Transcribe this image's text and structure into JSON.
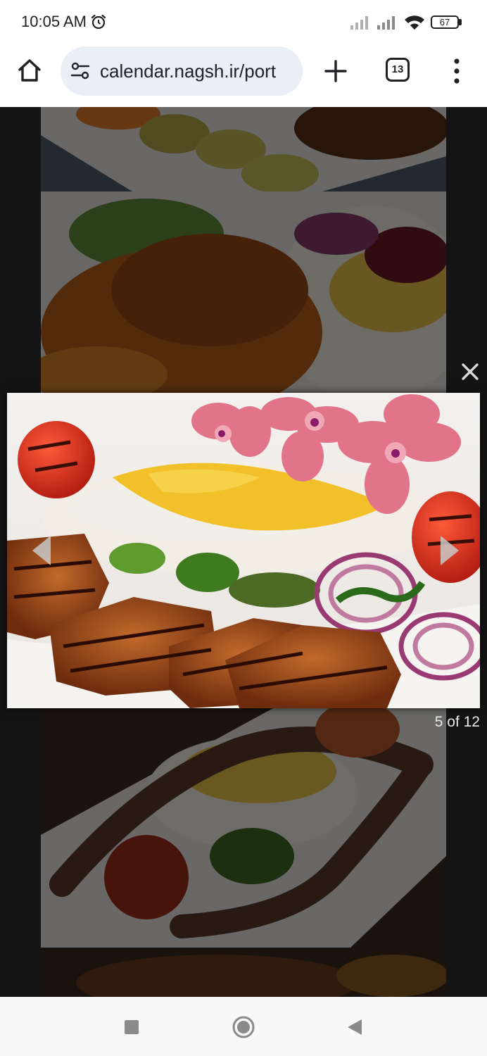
{
  "status": {
    "time": "10:05 AM",
    "battery": "67"
  },
  "browser": {
    "url": "calendar.nagsh.ir/port",
    "tab_count": "13"
  },
  "gallery": {
    "counter": "5 of 12"
  },
  "icons": {
    "alarm": "alarm-icon",
    "signal": "signal-icon",
    "wifi": "wifi-icon",
    "home": "home-icon",
    "site_settings": "tune-icon",
    "new_tab": "plus-icon",
    "menu": "more-vert-icon",
    "close": "close-icon",
    "prev": "arrow-left-icon",
    "next": "arrow-right-icon",
    "recents": "square-icon",
    "home_nav": "circle-icon",
    "back": "triangle-back-icon"
  }
}
